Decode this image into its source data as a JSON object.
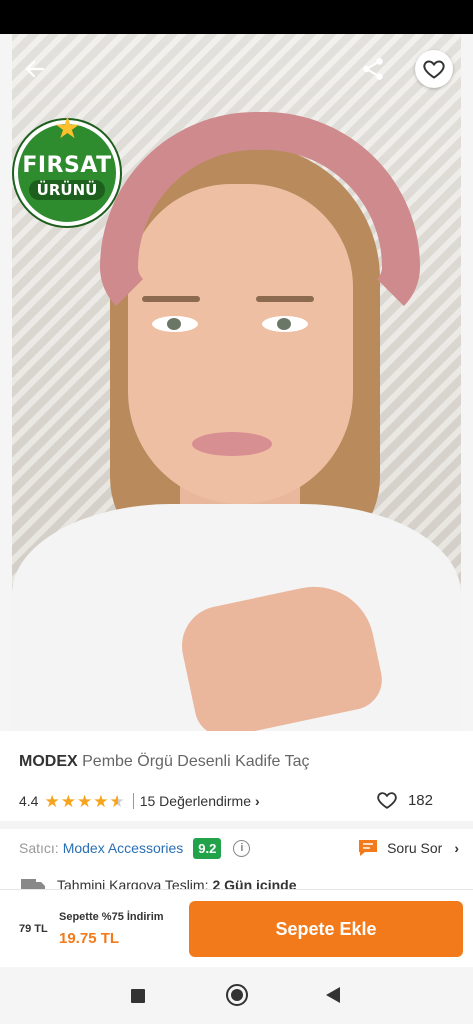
{
  "product": {
    "brand": "MODEX",
    "name": "Pembe Örgü Desenli Kadife Taç",
    "badge_line1": "FIRSAT",
    "badge_line2": "ÜRÜNÜ"
  },
  "rating": {
    "value": "4.4",
    "stars": 4.4,
    "reviews_label": "15 Değerlendirme",
    "likes": "182"
  },
  "seller": {
    "label": "Satıcı:",
    "name": "Modex Accessories",
    "score": "9.2",
    "ask_label": "Soru Sor"
  },
  "shipping": {
    "label": "Tahmini Kargoya Teslim:",
    "days": "2 Gün içinde"
  },
  "cart": {
    "old_price": "79 TL",
    "discount_label": "Sepette %75 İndirim",
    "new_price": "19.75 TL",
    "button_label": "Sepete Ekle"
  },
  "colors": {
    "accent": "#f27a1a",
    "link": "#2a6fb3",
    "score_green": "#22a34a",
    "star": "#f7a41d"
  },
  "icons": [
    "back-arrow-icon",
    "share-icon",
    "heart-icon",
    "star-icon",
    "info-icon",
    "chat-icon",
    "chevron-right-icon",
    "truck-icon"
  ]
}
